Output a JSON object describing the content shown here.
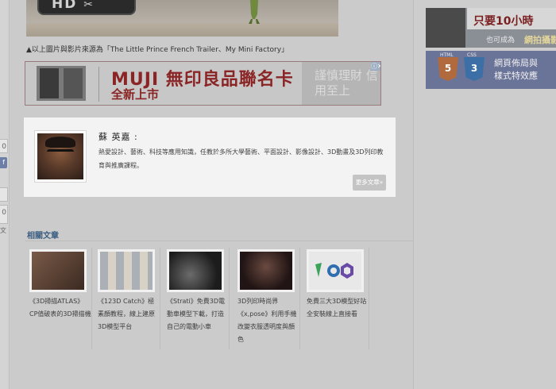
{
  "left": {
    "count_top": "0",
    "share_label": "f",
    "count_bottom": "0",
    "label_bottom": "文"
  },
  "hero": {
    "badge_text": "HD"
  },
  "caption": "▲以上圖片與影片來源為「The Little Prince French Trailer、My Mini Factory」",
  "ad": {
    "title": "MUJI 無印良品聯名卡",
    "subtitle": "全新上市",
    "right_text": "謹慎理財 信用至上",
    "close_label": "ⓘ✕"
  },
  "author": {
    "name": "蘇 英嘉 :",
    "bio": "熱愛設計、藝術、科技等應用知識，任教於多所大學藝術、平面設計、影像設計、3D動畫及3D列印教育與推廣課程。",
    "more_button": "更多文章»"
  },
  "related": {
    "heading": "相關文章",
    "items": [
      {
        "text": "《3D掃描ATLAS》CP值破表的3D掃描機",
        "thumb_color": "#6e4a3a"
      },
      {
        "text": "《123D Catch》極素顏教程，線上建原3D模型平台",
        "thumb_color": "#9aa0a8"
      },
      {
        "text": "《Strati》免費3D電動車模型下載，打造自己的電動小車",
        "thumb_color": "#3a3a3a"
      },
      {
        "text": "3D列印時尚界《x,pose》利用手機改變衣服透明度與顏色",
        "thumb_color": "#4a2e2a"
      },
      {
        "text": "免費三大3D模型好站全安裝線上直接看",
        "thumb_color": "#e4e4e4"
      }
    ]
  },
  "right_ads": {
    "ad1": {
      "line1": "只要10小時",
      "line2": "也可成為",
      "line3": "網拍攝影達"
    },
    "ad2": {
      "html_label": "HTML",
      "html_num": "5",
      "css_label": "CSS",
      "css_num": "3",
      "text": "網頁佈局與\n樣式特效應"
    }
  }
}
